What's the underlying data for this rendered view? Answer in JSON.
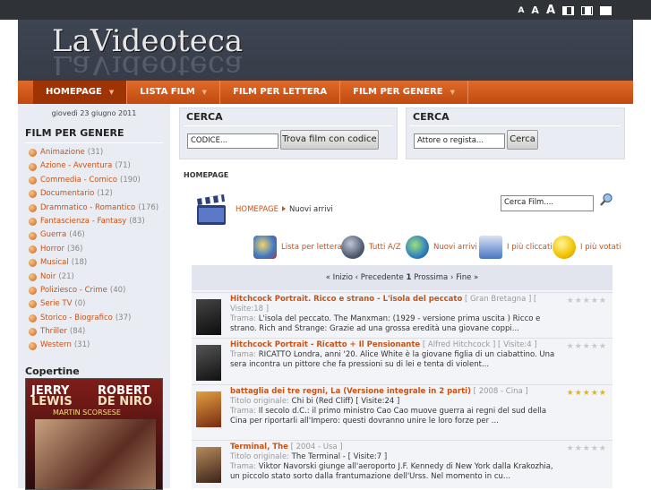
{
  "topbar": {
    "font_small": "A",
    "font_medium": "A",
    "font_large": "A"
  },
  "logo": {
    "text": "LaVideoteca"
  },
  "nav": [
    {
      "label": "HOMEPAGE",
      "active": true,
      "arrow": true
    },
    {
      "label": "LISTA FILM",
      "active": false,
      "arrow": true
    },
    {
      "label": "FILM PER LETTERA",
      "active": false,
      "arrow": false
    },
    {
      "label": "FILM PER GENERE",
      "active": false,
      "arrow": true
    }
  ],
  "sidebar": {
    "date": "giovedì 23 giugno 2011",
    "genres_title": "FILM PER GENERE",
    "genres": [
      {
        "name": "Animazione",
        "count": "(31)"
      },
      {
        "name": "Azione - Avventura",
        "count": "(71)"
      },
      {
        "name": "Commedia - Comico",
        "count": "(190)"
      },
      {
        "name": "Documentario",
        "count": "(12)"
      },
      {
        "name": "Drammatico - Romantico",
        "count": "(176)"
      },
      {
        "name": "Fantascienza - Fantasy",
        "count": "(83)"
      },
      {
        "name": "Guerra",
        "count": "(46)"
      },
      {
        "name": "Horror",
        "count": "(36)"
      },
      {
        "name": "Musical",
        "count": "(18)"
      },
      {
        "name": "Noir",
        "count": "(21)"
      },
      {
        "name": "Poliziesco - Crime",
        "count": "(40)"
      },
      {
        "name": "Serie TV",
        "count": "(0)"
      },
      {
        "name": "Storico - Biografico",
        "count": "(37)"
      },
      {
        "name": "Thriller",
        "count": "(84)"
      },
      {
        "name": "Western",
        "count": "(31)"
      }
    ],
    "covers_title": "Copertine",
    "cover": {
      "name1": "JERRY",
      "name2": "ROBERT",
      "name3": "LEWIS",
      "name4": "DE NIRO",
      "director": "MARTIN SCORSESE"
    }
  },
  "search_code": {
    "title": "CERCA",
    "value": "CODICE...",
    "button": "Trova film con codice"
  },
  "search_actor": {
    "title": "CERCA",
    "value": "Attore o regista...",
    "button": "Cerca"
  },
  "breadcrumb": {
    "heading": "HOMEPAGE",
    "home": "HOMEPAGE",
    "current": "Nuovi arrivi",
    "search_value": "Cerca Film...."
  },
  "quicklinks": [
    {
      "label": "Lista per lettera",
      "icon": "letters-icon"
    },
    {
      "label": "Tutti A/Z",
      "icon": "people-icon"
    },
    {
      "label": "Nuovi arrivi",
      "icon": "globe-icon"
    },
    {
      "label": "I più cliccati",
      "icon": "computer-icon"
    },
    {
      "label": "I più votati",
      "icon": "smiley-icon"
    }
  ],
  "pager": {
    "text_left": "« Inizio ‹ Precedente",
    "current": "1",
    "text_right": "Prossima › Fine »"
  },
  "films": [
    {
      "title": "Hitchcock Portrait. Ricco e strano - L'isola del peccato",
      "meta": "[ Gran Bretagna ] [ Visite:18 ]",
      "orig_label": "",
      "orig": "",
      "trama_label": "Trama:",
      "trama": "L'isola del peccato. The Manxman: (1929 - versione prima uscita ) Ricco e strano. Rich and Strange: Grazie ad una grossa eredità una giovane coppi...",
      "rating": 0
    },
    {
      "title": "Hitchcock Portrait - Ricatto + Il Pensionante",
      "meta": "[ Alfred Hitchcock ] [ Visite:4 ]",
      "orig_label": "",
      "orig": "",
      "trama_label": "Trama:",
      "trama": "RICATTO Londra, anni '20. Alice White è la giovane figlia di un ciabattino. Una sera incontra un pittore che fa pressioni su di lei e tenta di violent...",
      "rating": 0
    },
    {
      "title": "battaglia dei tre regni, La (Versione integrale in 2 parti)",
      "meta": "[ 2008 - Cina ]",
      "orig_label": "Titolo originale:",
      "orig": "Chi bi (Red Cliff) [ Visite:24 ]",
      "trama_label": "Trama:",
      "trama": "Il secolo d.C.: il primo ministro Cao Cao muove guerra ai regni del sud della Cina per riportarli all'Impero: questi dovranno unire le loro forze per ...",
      "rating": 5
    },
    {
      "title": "Terminal, The",
      "meta": "[ 2004 - Usa ]",
      "orig_label": "Titolo originale:",
      "orig": "The Terminal - [ Visite:7 ]",
      "trama_label": "Trama:",
      "trama": "Viktor Navorski giunge all'aeroporto J.F. Kennedy di New York dalla Krakozhia, un piccolo stato sorto dalla frantumazione dell'Urss. Nel momento in cu...",
      "rating": 0
    }
  ],
  "colors": {
    "accent": "#c4541a",
    "nav": "#d45a1c",
    "header": "#3a414e",
    "panel": "#e9ecf2"
  }
}
